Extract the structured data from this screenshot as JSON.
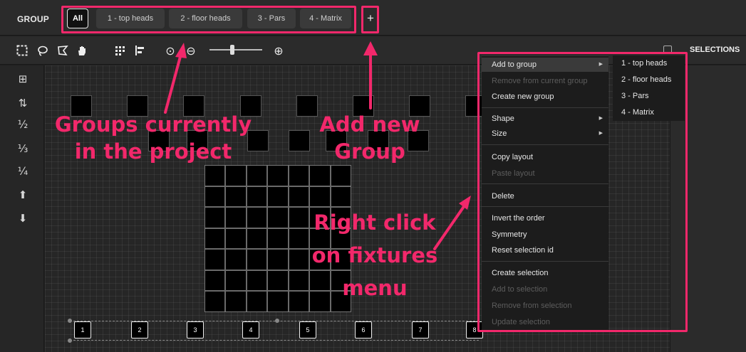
{
  "header": {
    "group_label": "GROUP",
    "tabs": [
      {
        "label": "All"
      },
      {
        "label": "1 - top heads"
      },
      {
        "label": "2 - floor heads"
      },
      {
        "label": "3 - Pars"
      },
      {
        "label": "4 - Matrix"
      }
    ],
    "add_label": "+"
  },
  "toolbar": {
    "tools": [
      "rect-select-icon",
      "lasso-icon",
      "polygon-select-icon",
      "hand-pan-icon",
      "grid-arrange-icon",
      "align-icon",
      "zoom-fit-icon",
      "zoom-out-icon",
      "zoom-in-icon"
    ],
    "zoom_out_glyph": "⊖",
    "zoom_in_glyph": "⊕",
    "zoom_fit_glyph": "⊙"
  },
  "selections_panel": {
    "title": "SELECTIONS"
  },
  "sidebar": {
    "glyphs": [
      "⊞",
      "⇅",
      "½",
      "⅓",
      "¼",
      "⬆",
      "⬇"
    ]
  },
  "fixtures": {
    "numbered": [
      "1",
      "2",
      "3",
      "4",
      "5",
      "6",
      "7",
      "8"
    ]
  },
  "context_menu": {
    "items": [
      {
        "label": "Add to group",
        "disabled": false,
        "submenu": true,
        "active": true
      },
      {
        "label": "Remove from current group",
        "disabled": true
      },
      {
        "label": "Create new group",
        "disabled": false
      },
      {
        "label": "Shape",
        "disabled": false,
        "submenu": true
      },
      {
        "label": "Size",
        "disabled": false,
        "submenu": true
      },
      {
        "label": "Copy layout",
        "disabled": false
      },
      {
        "label": "Paste layout",
        "disabled": true
      },
      {
        "label": "Delete",
        "disabled": false
      },
      {
        "label": "Invert the order",
        "disabled": false
      },
      {
        "label": "Symmetry",
        "disabled": false
      },
      {
        "label": "Reset selection id",
        "disabled": false
      },
      {
        "label": "Create selection",
        "disabled": false
      },
      {
        "label": "Add to selection",
        "disabled": true
      },
      {
        "label": "Remove from selection",
        "disabled": true
      },
      {
        "label": "Update selection",
        "disabled": true
      }
    ],
    "submenu": [
      "1 - top heads",
      "2 - floor heads",
      "3 - Pars",
      "4 - Matrix"
    ]
  },
  "annotations": {
    "groups_line1": "Groups currently",
    "groups_line2": "in the project",
    "add_line1": "Add new",
    "add_line2": "Group",
    "right_line1": "Right click",
    "right_line2": "on fixtures",
    "right_line3": "menu"
  },
  "colors": {
    "annotation": "#f2286b",
    "background": "#262626",
    "bar": "#2b2b2b"
  }
}
